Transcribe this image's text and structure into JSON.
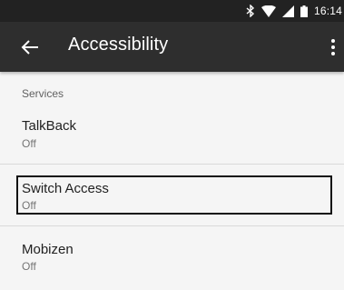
{
  "status_bar": {
    "time": "16:14",
    "icons": [
      "bluetooth-icon",
      "wifi-icon",
      "signal-icon",
      "battery-icon"
    ]
  },
  "app_bar": {
    "title": "Accessibility",
    "back_icon": "back-arrow-icon",
    "menu_icon": "overflow-menu-icon"
  },
  "section": {
    "header": "Services",
    "items": [
      {
        "title": "TalkBack",
        "status": "Off"
      },
      {
        "title": "Switch Access",
        "status": "Off"
      },
      {
        "title": "Mobizen",
        "status": "Off"
      }
    ]
  },
  "colors": {
    "status_bar_bg": "#222222",
    "app_bar_bg": "#2e2e2e",
    "page_bg": "#f5f5f5",
    "focus_border": "#111111"
  }
}
